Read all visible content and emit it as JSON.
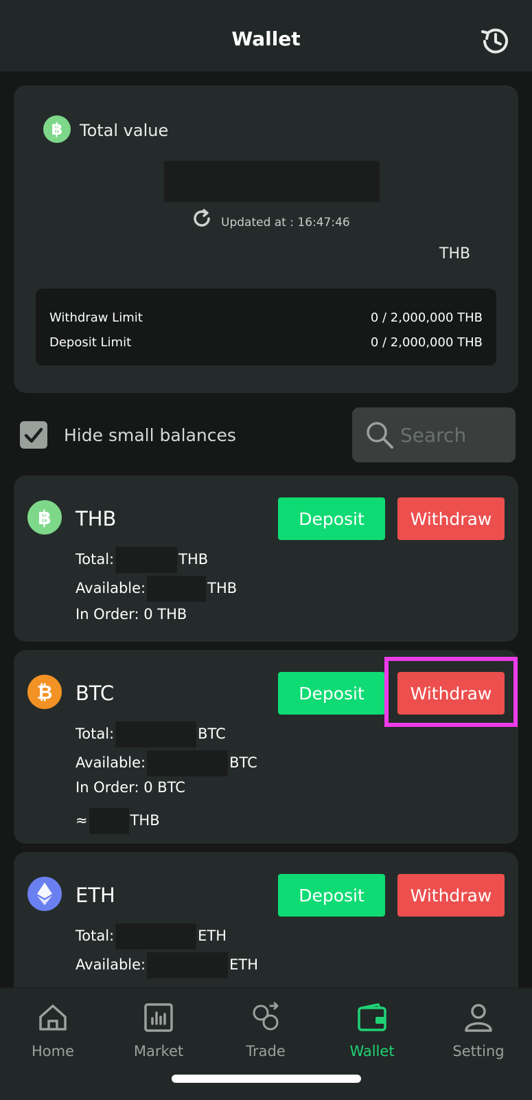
{
  "header": {
    "title": "Wallet",
    "history_icon": "history-icon"
  },
  "summary": {
    "label": "Total value",
    "updated_label": "Updated at : 16:47:46",
    "currency": "THB",
    "limits": [
      {
        "label": "Withdraw Limit",
        "value": "0 / 2,000,000 THB"
      },
      {
        "label": "Deposit Limit",
        "value": "0 / 2,000,000 THB"
      }
    ]
  },
  "filters": {
    "hide_small_label": "Hide small balances",
    "hide_small_checked": true,
    "search_placeholder": "Search"
  },
  "assets": [
    {
      "symbol": "THB",
      "color": "#7ed88a",
      "deposit_label": "Deposit",
      "withdraw_label": "Withdraw",
      "total_label": "Total:",
      "total_unit": "THB",
      "available_label": "Available:",
      "available_unit": "THB",
      "in_order": "In Order: 0 THB"
    },
    {
      "symbol": "BTC",
      "color": "#f39224",
      "deposit_label": "Deposit",
      "withdraw_label": "Withdraw",
      "total_label": "Total:",
      "total_unit": "BTC",
      "available_label": "Available:",
      "available_unit": "BTC",
      "in_order": "In Order: 0 BTC",
      "approx_prefix": "≈",
      "approx_unit": "THB"
    },
    {
      "symbol": "ETH",
      "color": "#6a7ff0",
      "deposit_label": "Deposit",
      "withdraw_label": "Withdraw",
      "total_label": "Total:",
      "total_unit": "ETH",
      "available_label": "Available:",
      "available_unit": "ETH"
    }
  ],
  "nav": [
    {
      "label": "Home",
      "icon": "home-icon"
    },
    {
      "label": "Market",
      "icon": "market-icon"
    },
    {
      "label": "Trade",
      "icon": "trade-icon"
    },
    {
      "label": "Wallet",
      "icon": "wallet-icon",
      "active": true
    },
    {
      "label": "Setting",
      "icon": "setting-icon"
    }
  ],
  "colors": {
    "background": "#151817",
    "card": "#252b2a",
    "deposit": "#0fdb74",
    "withdraw": "#ec4f4e",
    "active_nav": "#1fd376",
    "highlight": "#ee3bea"
  }
}
